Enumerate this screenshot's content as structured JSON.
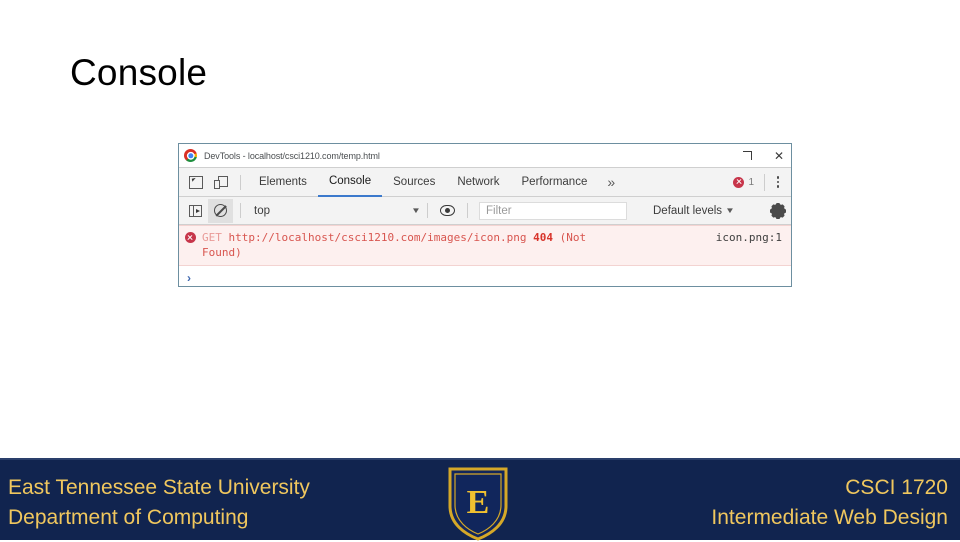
{
  "slide": {
    "title": "Console"
  },
  "devtools": {
    "titlebar": {
      "title": "DevTools - localhost/csci1210.com/temp.html",
      "chrome_icon": "chrome-logo-icon",
      "restore_label": "⌜",
      "close_label": "✕"
    },
    "toolbar": {
      "inspect_icon": "inspect-element-icon",
      "device_icon": "device-toolbar-icon",
      "tabs": [
        {
          "label": "Elements",
          "active": false
        },
        {
          "label": "Console",
          "active": true
        },
        {
          "label": "Sources",
          "active": false
        },
        {
          "label": "Network",
          "active": false
        },
        {
          "label": "Performance",
          "active": false
        }
      ],
      "more_tabs_label": "»",
      "error_count": "1",
      "menu_icon": "kebab-menu-icon"
    },
    "filterbar": {
      "sidebar_icon": "console-sidebar-icon",
      "clear_icon": "clear-console-icon",
      "context_value": "top",
      "context_caret": "▼",
      "eye_icon": "live-expression-icon",
      "filter_placeholder": "Filter",
      "levels_label": "Default levels",
      "levels_caret": "▼",
      "settings_icon": "settings-gear-icon"
    },
    "console": {
      "error": {
        "icon": "error-circle-icon",
        "method": "GET",
        "url": "http://localhost/csci1210.com/images/icon.png",
        "status": "404",
        "status_text": "(Not Found)",
        "source": "icon.png:1"
      },
      "prompt_chevron": "›"
    }
  },
  "footer": {
    "university": "East Tennessee State University",
    "department": "Department of Computing",
    "course_code": "CSCI 1720",
    "course_name": "Intermediate Web Design",
    "logo_letter": "E",
    "logo_name": "etsu-shield-logo",
    "colors": {
      "background": "#11244f",
      "text": "#f0c75e"
    }
  }
}
